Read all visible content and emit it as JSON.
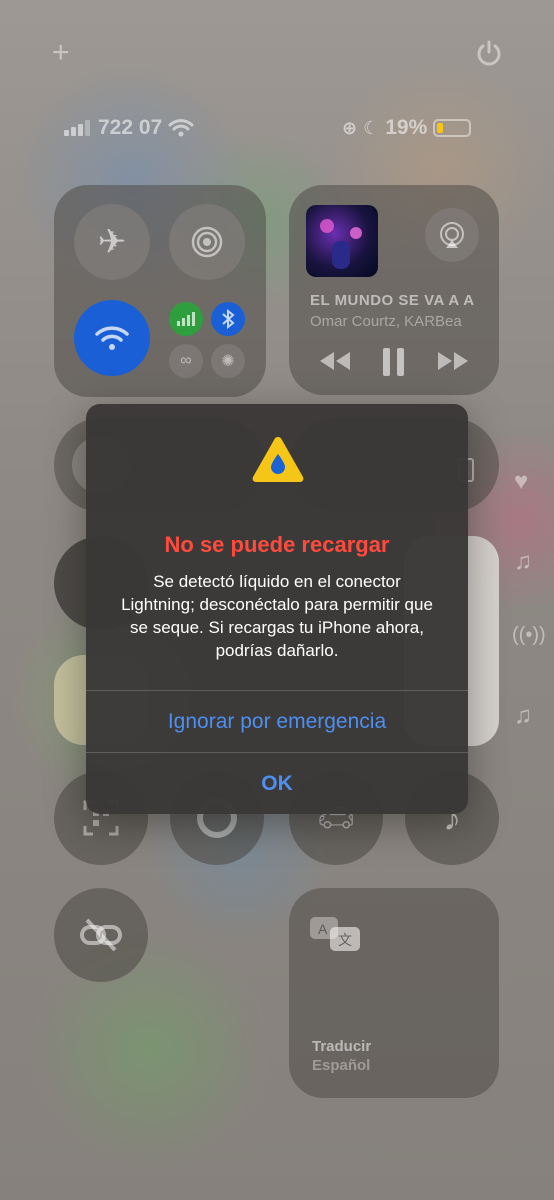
{
  "status_bar": {
    "carrier": "722 07",
    "battery_percent": "19%",
    "battery_level": 0.19,
    "battery_color": "#f5c518"
  },
  "top_controls": {
    "add_icon": "plus-icon",
    "power_icon": "power-icon"
  },
  "now_playing": {
    "title": "EL MUNDO SE VA A A",
    "artist": "Omar Courtz, KARBea"
  },
  "translate_tile": {
    "label": "Traducir",
    "language": "Español"
  },
  "alert": {
    "icon": "water-warning-icon",
    "title": "No se puede recargar",
    "message": "Se detectó líquido en el conector Lightning; desconéctalo para permitir que se seque. Si recargas tu iPhone ahora, podrías dañarlo.",
    "emergency_button": "Ignorar por emergencia",
    "ok_button": "OK",
    "title_color": "#ff4a3d",
    "button_color": "#4d8ff0"
  },
  "colors": {
    "wifi_active": "#1a5fd6",
    "cellular_active": "#2f9e3e",
    "bluetooth_active": "#1a5fd6"
  }
}
